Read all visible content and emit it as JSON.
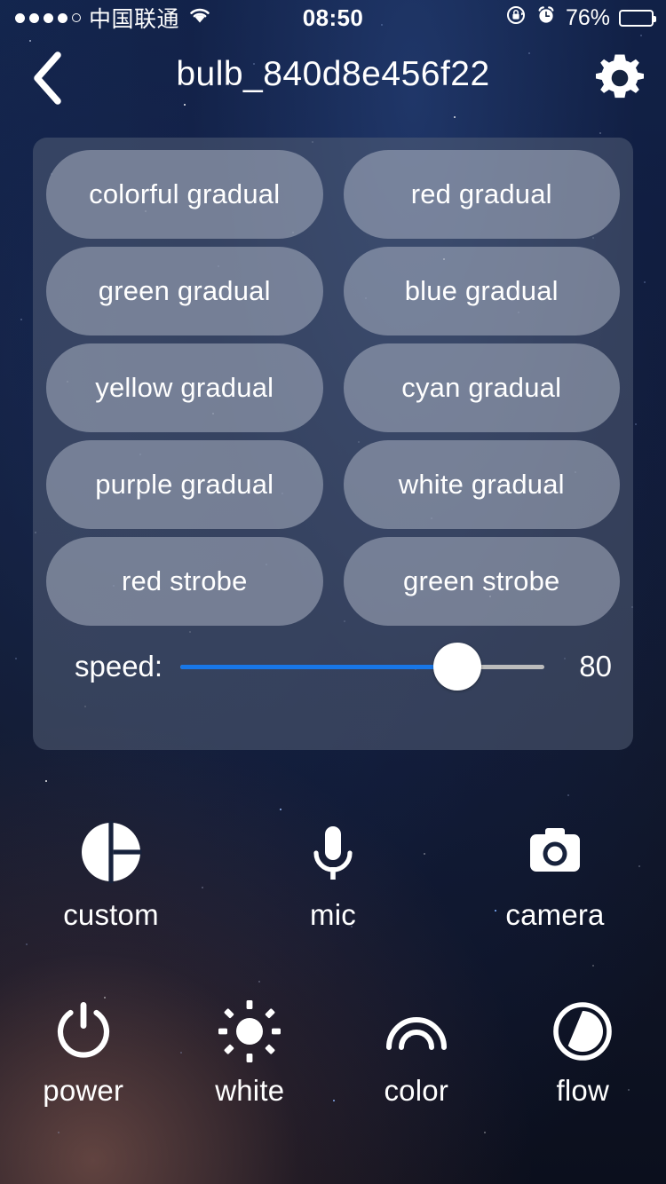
{
  "status_bar": {
    "signal_dots_filled": 4,
    "signal_dots_total": 5,
    "carrier": "中国联通",
    "wifi_icon": "wifi-icon",
    "time": "08:50",
    "rotation_lock_icon": "rotation-lock-icon",
    "alarm_icon": "alarm-clock-icon",
    "battery_percent": "76%",
    "battery_level": 76
  },
  "nav": {
    "back_icon": "chevron-left-icon",
    "title": "bulb_840d8e456f22",
    "settings_icon": "gear-icon"
  },
  "effects": {
    "buttons": [
      {
        "label": "colorful gradual"
      },
      {
        "label": "red gradual"
      },
      {
        "label": "green gradual"
      },
      {
        "label": "blue gradual"
      },
      {
        "label": "yellow gradual"
      },
      {
        "label": "cyan gradual"
      },
      {
        "label": "purple gradual"
      },
      {
        "label": "white gradual"
      },
      {
        "label": "red strobe"
      },
      {
        "label": "green strobe"
      }
    ]
  },
  "speed_slider": {
    "label": "speed:",
    "value": "80",
    "percent": 76,
    "min": 0,
    "max": 100,
    "fill_color": "#1877e8",
    "track_color": "#bcbcbc",
    "thumb_color": "#ffffff"
  },
  "tools_row": [
    {
      "label": "custom",
      "icon": "color-wheel-icon"
    },
    {
      "label": "mic",
      "icon": "microphone-icon"
    },
    {
      "label": "camera",
      "icon": "camera-icon"
    }
  ],
  "modes_row": [
    {
      "label": "power",
      "icon": "power-icon"
    },
    {
      "label": "white",
      "icon": "brightness-sun-icon"
    },
    {
      "label": "color",
      "icon": "rainbow-icon"
    },
    {
      "label": "flow",
      "icon": "flow-clock-icon"
    }
  ],
  "theme": {
    "panel_bg": "#566178",
    "button_bg": "#bac1ce",
    "text_color": "#ffffff",
    "background": "#101728"
  }
}
